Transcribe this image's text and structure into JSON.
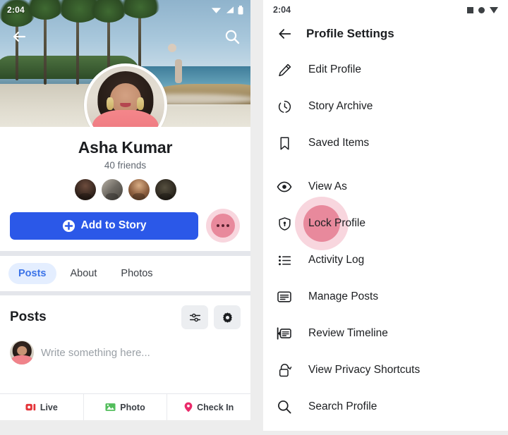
{
  "left": {
    "status": {
      "time": "2:04",
      "icons": [
        "wifi-icon",
        "signal-icon",
        "battery-icon"
      ]
    },
    "nav": {
      "back": "back-arrow-icon",
      "search": "search-icon"
    },
    "profile": {
      "name": "Asha Kumar",
      "friends": "40 friends",
      "avatar_alt": "profile-photo",
      "cover_alt": "beach-cover-photo",
      "friend_avatars": [
        "friend-1",
        "friend-2",
        "friend-3",
        "friend-4"
      ]
    },
    "actions": {
      "add_story": "Add to Story",
      "add_story_icon": "plus-circle-icon",
      "more_label": "more-options",
      "more_highlighted": true
    },
    "tabs": [
      {
        "label": "Posts",
        "active": true
      },
      {
        "label": "About",
        "active": false
      },
      {
        "label": "Photos",
        "active": false
      }
    ],
    "posts": {
      "title": "Posts",
      "filter_icon": "filters-icon",
      "settings_icon": "gear-icon"
    },
    "composer": {
      "placeholder": "Write something here..."
    },
    "bottom_bar": [
      {
        "label": "Live",
        "icon": "live-video-icon",
        "color": "#e4353a"
      },
      {
        "label": "Photo",
        "icon": "photo-icon",
        "color": "#52bd5b"
      },
      {
        "label": "Check In",
        "icon": "location-pin-icon",
        "color": "#ea2a6a"
      }
    ]
  },
  "right": {
    "status": {
      "time": "2:04",
      "icons": [
        "square-icon",
        "circle-icon",
        "triangle-icon"
      ]
    },
    "header": {
      "back_icon": "back-arrow-icon",
      "title": "Profile Settings"
    },
    "menu": [
      {
        "label": "Edit Profile",
        "icon": "pencil-icon",
        "highlighted": false
      },
      {
        "label": "Story Archive",
        "icon": "clock-archive-icon",
        "highlighted": false
      },
      {
        "label": "Saved Items",
        "icon": "bookmark-icon",
        "highlighted": false
      },
      {
        "label": "View As",
        "icon": "eye-icon",
        "highlighted": false
      },
      {
        "label": "Lock Profile",
        "icon": "shield-lock-icon",
        "highlighted": true
      },
      {
        "label": "Activity Log",
        "icon": "list-icon",
        "highlighted": false
      },
      {
        "label": "Manage Posts",
        "icon": "manage-posts-icon",
        "highlighted": false
      },
      {
        "label": "Review Timeline",
        "icon": "review-timeline-icon",
        "highlighted": false
      },
      {
        "label": "View Privacy Shortcuts",
        "icon": "lock-icon",
        "highlighted": false
      },
      {
        "label": "Search Profile",
        "icon": "search-icon",
        "highlighted": false
      }
    ]
  },
  "colors": {
    "accent_blue": "#2b58e8",
    "tab_active_bg": "#e4eeff",
    "tab_active_text": "#3b73e8",
    "tap_highlight": "#e8899c",
    "tap_halo": "#f6cfd8",
    "page_bg": "#ededed"
  }
}
